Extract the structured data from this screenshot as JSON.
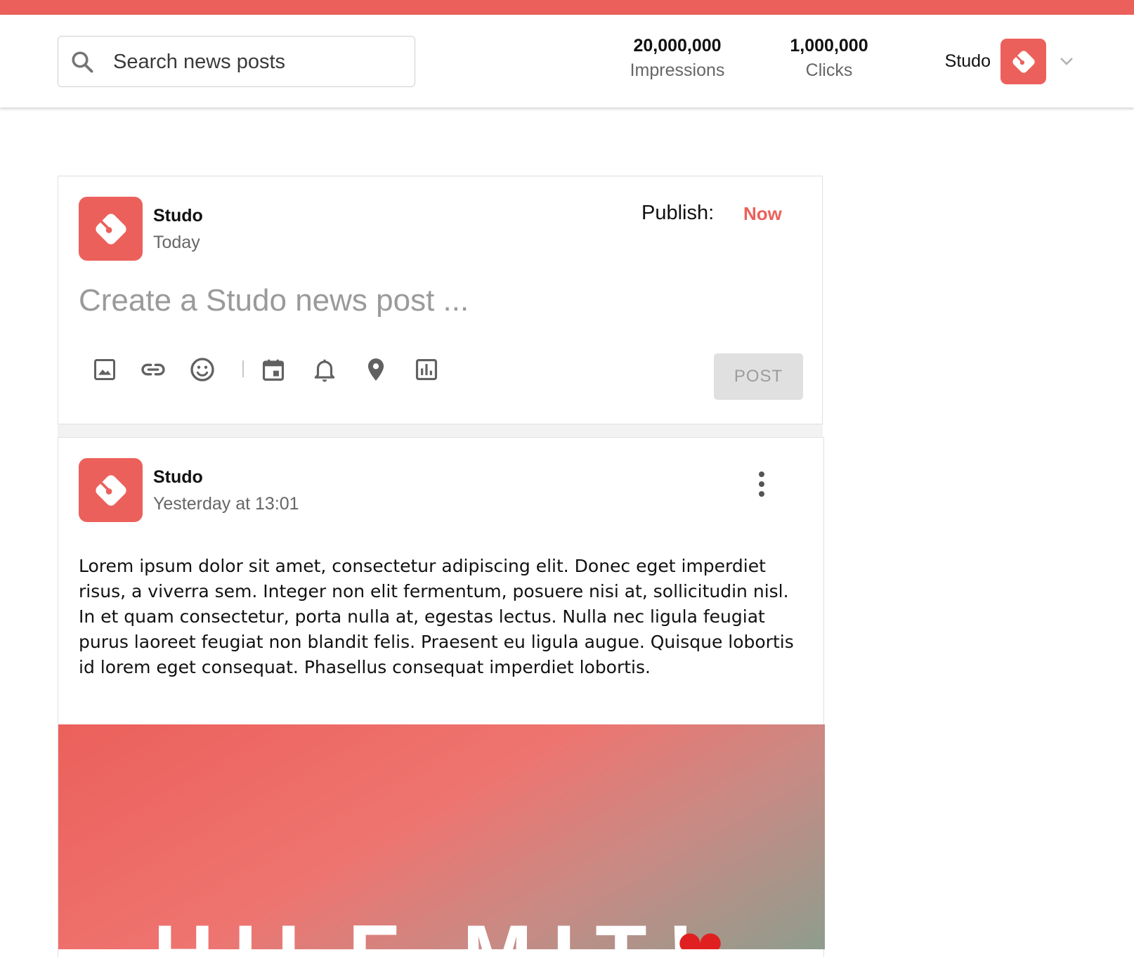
{
  "header": {
    "search_placeholder": "Search news posts",
    "stats": [
      {
        "value": "20,000,000",
        "label": "Impressions"
      },
      {
        "value": "1,000,000",
        "label": "Clicks"
      }
    ],
    "user_name": "Studo"
  },
  "composer": {
    "author": "Studo",
    "time": "Today",
    "publish_label": "Publish:",
    "publish_value": "Now",
    "placeholder": "Create a Studo news post ...",
    "tools": [
      "image-icon",
      "link-icon",
      "emoji-icon",
      "calendar-icon",
      "bell-icon",
      "location-pin-icon",
      "poll-chart-icon"
    ],
    "post_button": "POST"
  },
  "post": {
    "author": "Studo",
    "time": "Yesterday at 13:01",
    "text": "Lorem ipsum dolor sit amet, consectetur adipiscing elit. Donec eget imperdiet risus, a viverra sem. Integer non elit fermentum, posuere nisi at, sollicitudin nisl. In et quam consectetur, porta nulla at, egestas lectus. Nulla nec ligula feugiat purus laoreet feugiat non blandit felis. Praesent eu ligula augue. Quisque lobortis id lorem eget consequat. Phasellus consequat imperdiet lobortis.",
    "image_caption": "HILF MIT!",
    "image_emoji": "❤"
  },
  "colors": {
    "brand": "#ec605b",
    "muted_text": "#666666",
    "button_disabled_bg": "#e0e0e0"
  }
}
